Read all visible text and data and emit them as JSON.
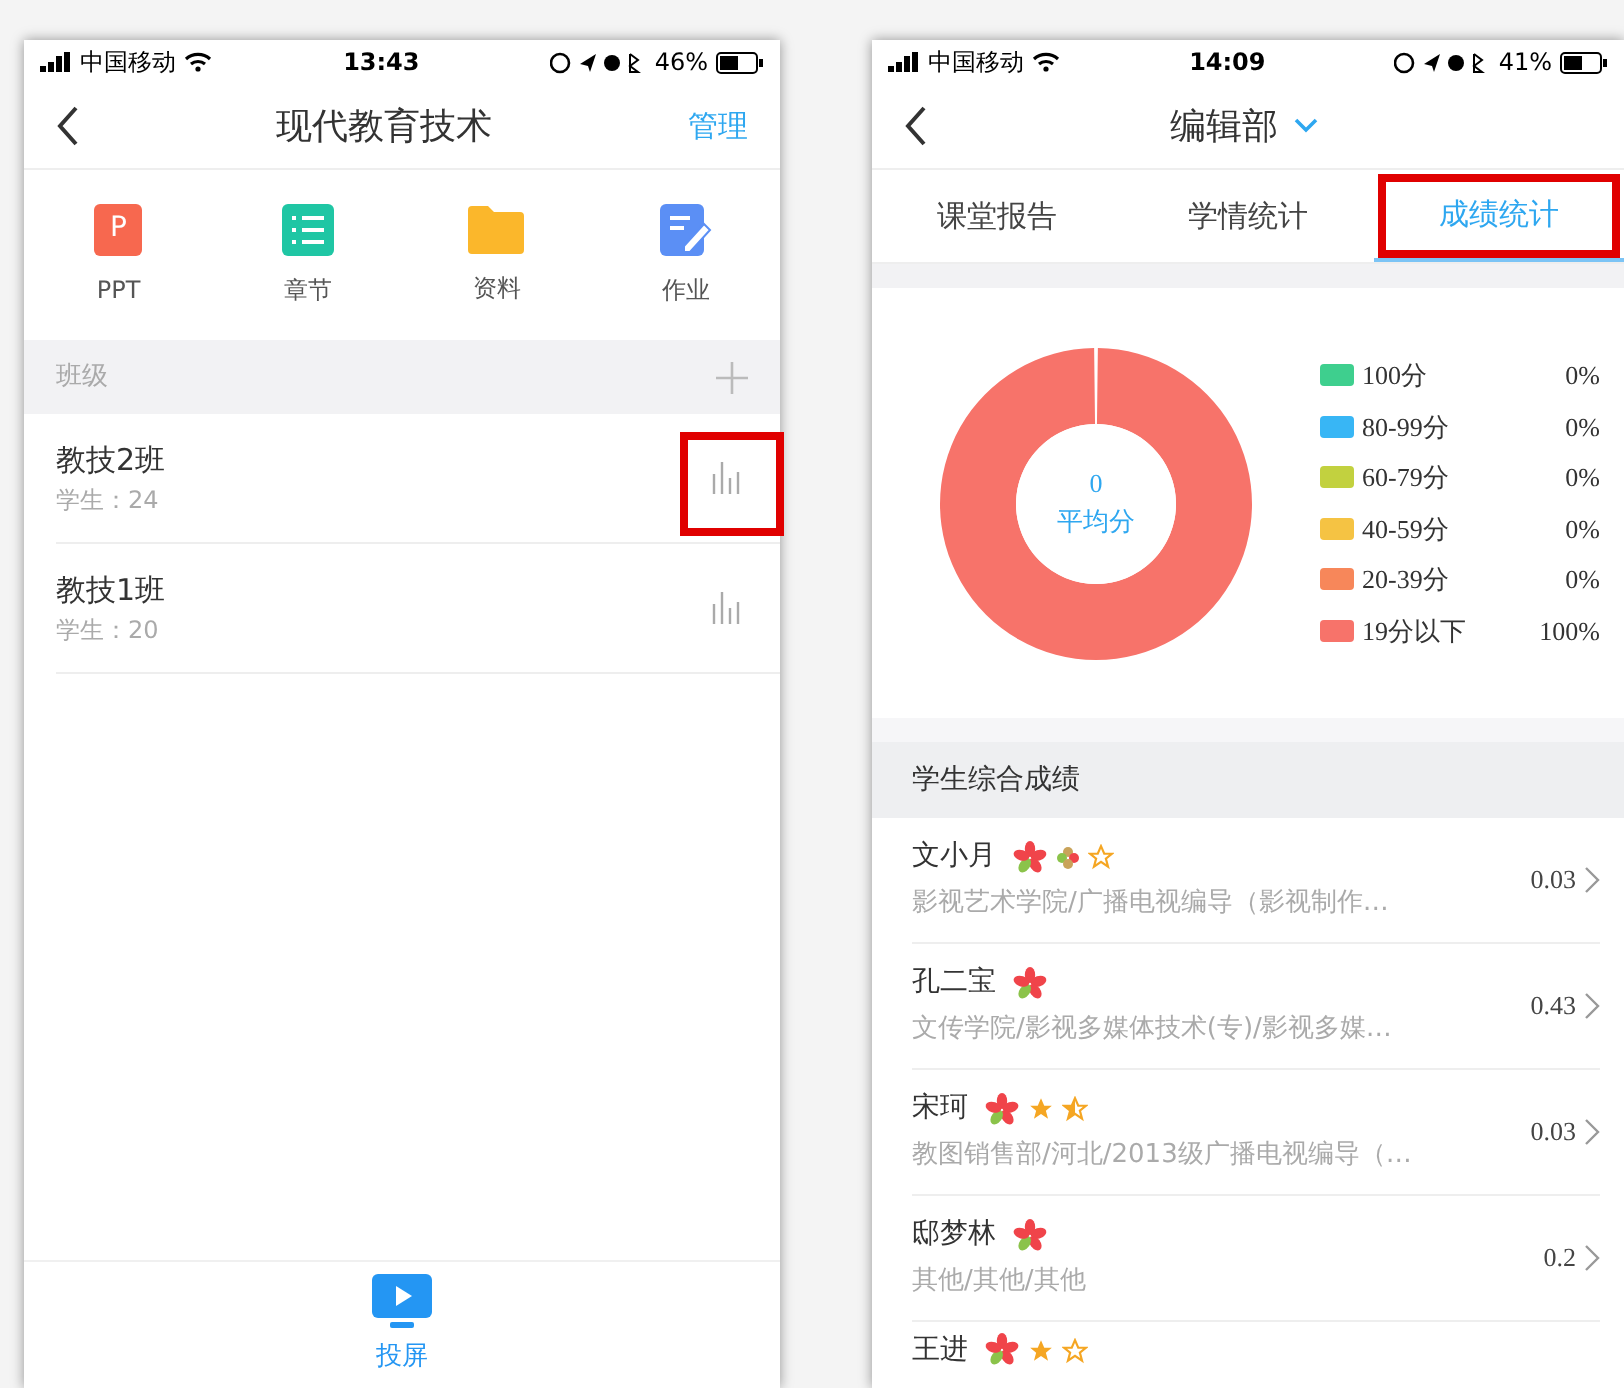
{
  "left_phone": {
    "status_bar": {
      "carrier": "中国移动",
      "time": "13:43",
      "battery": "46%"
    },
    "nav": {
      "title": "现代教育技术",
      "action": "管理"
    },
    "shortcuts": [
      {
        "kind": "ppt",
        "label": "PPT",
        "glyph": "P"
      },
      {
        "kind": "chapter",
        "label": "章节"
      },
      {
        "kind": "folder",
        "label": "资料"
      },
      {
        "kind": "homework",
        "label": "作业"
      }
    ],
    "section": {
      "title": "班级"
    },
    "classes": [
      {
        "name": "教技2班",
        "students": "学生：24",
        "highlighted": true
      },
      {
        "name": "教技1班",
        "students": "学生：20",
        "highlighted": false
      }
    ],
    "bottom_action": {
      "label": "投屏"
    }
  },
  "right_phone": {
    "status_bar": {
      "carrier": "中国移动",
      "time": "14:09",
      "battery": "41%"
    },
    "nav": {
      "title": "编辑部"
    },
    "tabs": [
      {
        "label": "课堂报告",
        "selected": false,
        "highlighted": false
      },
      {
        "label": "学情统计",
        "selected": false,
        "highlighted": false
      },
      {
        "label": "成绩统计",
        "selected": true,
        "highlighted": true
      }
    ],
    "chart": {
      "center_value": "0",
      "center_label": "平均分",
      "legend": [
        {
          "percent": "0%",
          "color": "#3ecf8e"
        },
        {
          "percent": "0%",
          "color": "#38b6f5"
        },
        {
          "percent": "0%",
          "color": "#c2d13f"
        },
        {
          "percent": "0%",
          "color": "#f5c343"
        },
        {
          "percent": "0%",
          "color": "#f7875a"
        },
        {
          "percent": "100%",
          "color": "#f7736a"
        }
      ],
      "chart_data": {
        "type": "donut",
        "categories": [
          "100分",
          "80-99分",
          "60-79分",
          "40-59分",
          "20-39分",
          "19分以下"
        ],
        "values": [
          0,
          0,
          0,
          0,
          0,
          100
        ]
      }
    },
    "section": {
      "title": "学生综合成绩"
    },
    "students": [
      {
        "name": "文小月",
        "detail": "影视艺术学院/广播电视编导（影视制作…",
        "score": "0.03",
        "badges": [
          {
            "kind": "flower"
          },
          {
            "kind": "clover"
          },
          {
            "kind": "star_empty"
          }
        ]
      },
      {
        "name": "孔二宝",
        "detail": "文传学院/影视多媒体技术(专)/影视多媒…",
        "score": "0.43",
        "badges": [
          {
            "kind": "flower"
          }
        ]
      },
      {
        "name": "宋珂",
        "detail": "教图销售部/河北/2013级广播电视编导（…",
        "score": "0.03",
        "badges": [
          {
            "kind": "flower"
          },
          {
            "kind": "star_full"
          },
          {
            "kind": "star_half"
          }
        ]
      },
      {
        "name": "邸梦林",
        "detail": "其他/其他/其他",
        "score": "0.2",
        "badges": [
          {
            "kind": "flower"
          }
        ]
      },
      {
        "name": "王进",
        "badges": [
          {
            "kind": "flower"
          },
          {
            "kind": "star_full"
          },
          {
            "kind": "star_empty"
          }
        ]
      }
    ]
  }
}
